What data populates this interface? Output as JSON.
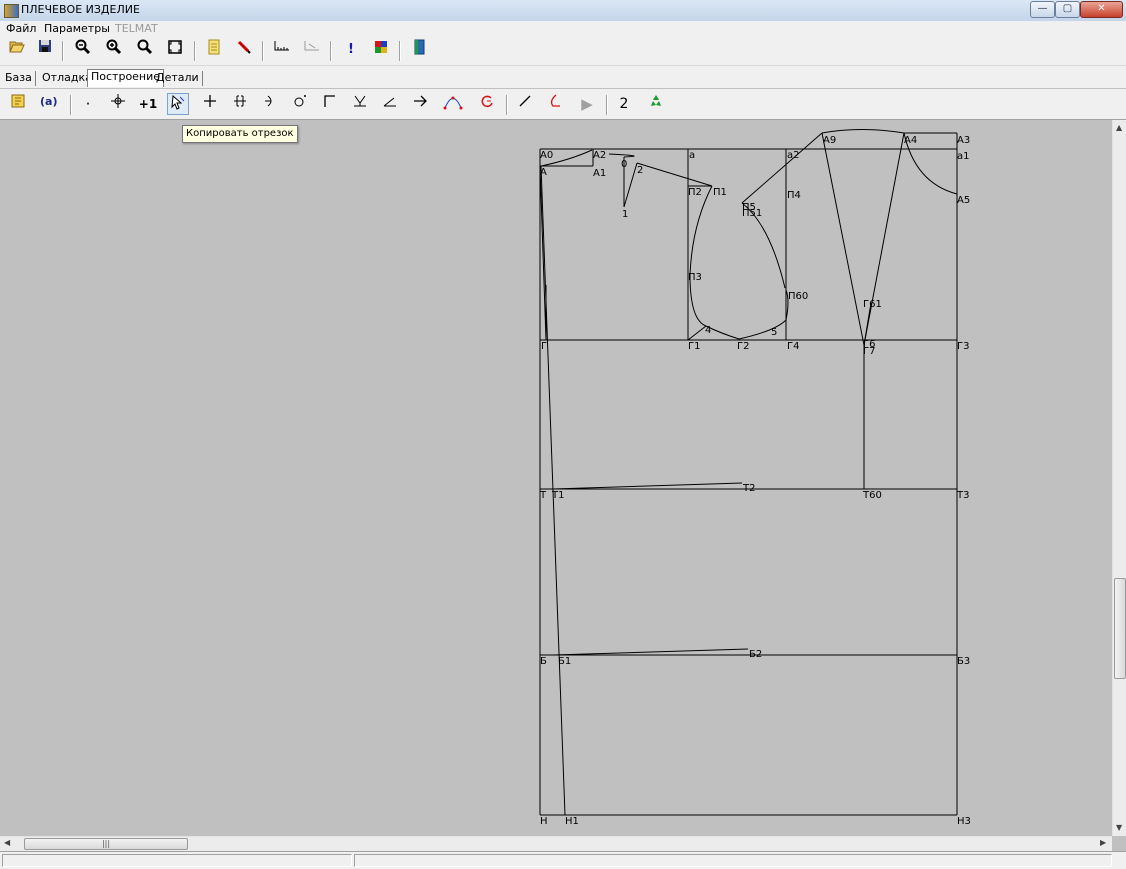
{
  "window": {
    "title": "ПЛЕЧЕВОЕ ИЗДЕЛИЕ"
  },
  "menu": [
    {
      "label": "Файл",
      "enabled": true
    },
    {
      "label": "Параметры",
      "enabled": true
    },
    {
      "label": "TELMAT",
      "enabled": false
    }
  ],
  "tabs": [
    "База",
    "Отладка",
    "Построение",
    "Детали"
  ],
  "active_tab": "Построение",
  "toolbar2": {
    "selected_tool": "copy-segment",
    "text_labels": {
      "add_one": "+1",
      "num_two": "2"
    }
  },
  "tooltip": "Копировать отрезок",
  "drawing_labels": {
    "A0": "A0",
    "A": "A",
    "A2": "A2",
    "A1": "A1",
    "zero": "0",
    "two": "2",
    "one": "1",
    "a": "a",
    "a2": "a2",
    "A9": "A9",
    "A4": "A4",
    "A3": "A3",
    "a1": "a1",
    "A5": "A5",
    "P2": "П2",
    "P1": "П1",
    "P4": "П4",
    "P5": "П5",
    "P51": "П51",
    "P3": "П3",
    "P60": "П60",
    "G61": "Г61",
    "four": "4",
    "five": "5",
    "G": "Г",
    "G1": "Г1",
    "G2": "Г2",
    "G4": "Г4",
    "G6": "Г6",
    "G7": "Г7",
    "G3": "Г3",
    "T": "Т",
    "T1": "Т1",
    "T2": "Т2",
    "T60": "Т60",
    "T3": "Т3",
    "B": "Б",
    "B1": "Б1",
    "B2": "Б2",
    "B3": "Б3",
    "H": "Н",
    "H1": "Н1",
    "H3": "Н3"
  }
}
